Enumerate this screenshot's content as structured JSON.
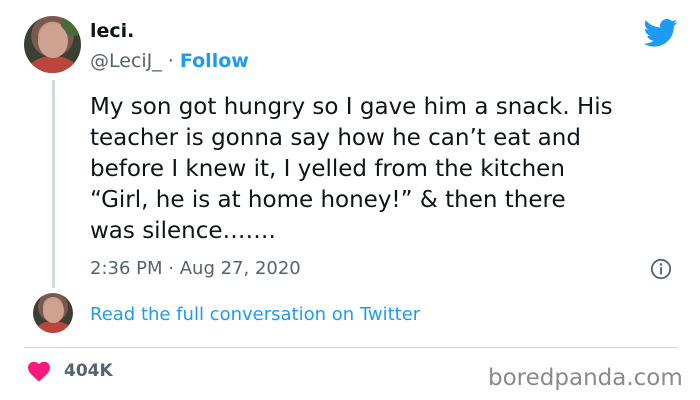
{
  "author": {
    "display_name": "leci.",
    "handle": "@LeciJ_",
    "separator": "·",
    "follow_label": "Follow"
  },
  "tweet": {
    "lines": [
      "My son got hungry so I gave him a snack. His",
      "teacher is gonna say how he can’t eat and",
      "before I knew it, I yelled from the kitchen",
      "“Girl, he is at home honey!”  & then there",
      "was silence……."
    ],
    "time": "2:36 PM",
    "separator": "·",
    "date": "Aug 27, 2020"
  },
  "conversation": {
    "link_text": "Read the full conversation on Twitter"
  },
  "engagement": {
    "likes": "404K"
  },
  "watermark": "boredpanda.com",
  "colors": {
    "twitter_blue": "#1d9bf0",
    "heart_red": "#f91880",
    "secondary_text": "#536471",
    "divider": "#cfd9de"
  },
  "icons": {
    "brand": "twitter-bird-icon",
    "info": "info-icon",
    "like": "heart-icon"
  }
}
